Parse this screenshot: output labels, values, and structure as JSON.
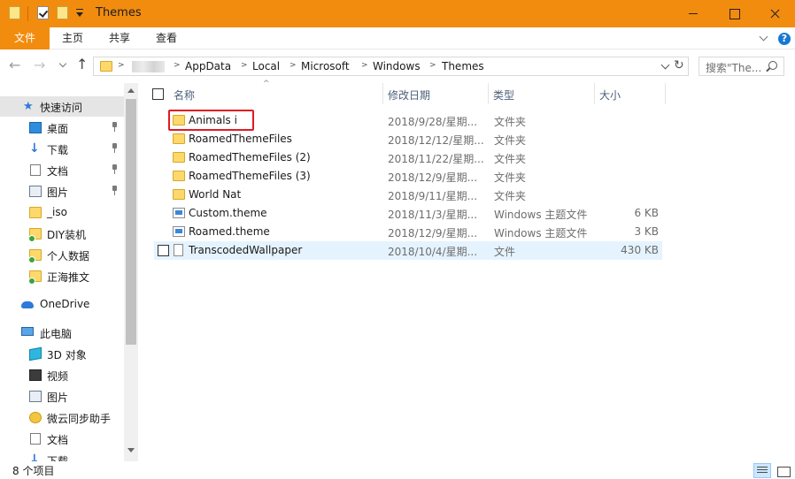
{
  "window": {
    "title": "Themes"
  },
  "ribbon": {
    "tabs": [
      "文件",
      "主页",
      "共享",
      "查看"
    ],
    "help_label": "?"
  },
  "nav": {
    "back_icon": "←",
    "forward_icon": "→",
    "up_icon": "↑",
    "breadcrumb": [
      "AppData",
      "Local",
      "Microsoft",
      "Windows",
      "Themes"
    ],
    "refresh_icon": "↻",
    "search_placeholder": "搜索\"The..."
  },
  "sidebar": {
    "quick_access": "快速访问",
    "quick_items": [
      {
        "label": "桌面",
        "icon": "desktop-icon",
        "pinned": true
      },
      {
        "label": "下载",
        "icon": "download-icon",
        "pinned": true
      },
      {
        "label": "文档",
        "icon": "document-icon",
        "pinned": true
      },
      {
        "label": "图片",
        "icon": "pictures-icon",
        "pinned": true
      },
      {
        "label": "_iso",
        "icon": "folder-icon",
        "pinned": false
      },
      {
        "label": "DIY装机",
        "icon": "folder-icon",
        "pinned": false
      },
      {
        "label": "个人数据",
        "icon": "folder-icon",
        "pinned": false
      },
      {
        "label": "正海推文",
        "icon": "folder-icon",
        "pinned": false
      }
    ],
    "onedrive": "OneDrive",
    "this_pc": "此电脑",
    "pc_items": [
      {
        "label": "3D 对象",
        "icon": "3d-objects-icon"
      },
      {
        "label": "视频",
        "icon": "video-icon"
      },
      {
        "label": "图片",
        "icon": "pictures-icon"
      },
      {
        "label": "微云同步助手",
        "icon": "weiyun-icon"
      },
      {
        "label": "文档",
        "icon": "document-icon"
      },
      {
        "label": "下载",
        "icon": "download-icon"
      }
    ]
  },
  "columns": {
    "name": "名称",
    "date": "修改日期",
    "type": "类型",
    "size": "大小",
    "sort_arrow": "^"
  },
  "files": [
    {
      "name": "Animals i",
      "date": "2018/9/28/星期...",
      "type": "文件夹",
      "size": "",
      "kind": "folder"
    },
    {
      "name": "RoamedThemeFiles",
      "date": "2018/12/12/星期...",
      "type": "文件夹",
      "size": "",
      "kind": "folder"
    },
    {
      "name": "RoamedThemeFiles (2)",
      "date": "2018/11/22/星期...",
      "type": "文件夹",
      "size": "",
      "kind": "folder"
    },
    {
      "name": "RoamedThemeFiles (3)",
      "date": "2018/12/9/星期...",
      "type": "文件夹",
      "size": "",
      "kind": "folder"
    },
    {
      "name": "World Nat",
      "date": "2018/9/11/星期...",
      "type": "文件夹",
      "size": "",
      "kind": "folder"
    },
    {
      "name": "Custom.theme",
      "date": "2018/11/3/星期...",
      "type": "Windows 主题文件",
      "size": "6 KB",
      "kind": "theme"
    },
    {
      "name": "Roamed.theme",
      "date": "2018/12/9/星期...",
      "type": "Windows 主题文件",
      "size": "3 KB",
      "kind": "theme"
    },
    {
      "name": "TranscodedWallpaper",
      "date": "2018/10/4/星期...",
      "type": "文件",
      "size": "430 KB",
      "kind": "file"
    }
  ],
  "status": {
    "count": "8 个项目"
  },
  "colors": {
    "accent": "#f28c0f",
    "selection": "#cce8ff",
    "hover": "#e5f3ff",
    "annotation": "#e11b22"
  }
}
